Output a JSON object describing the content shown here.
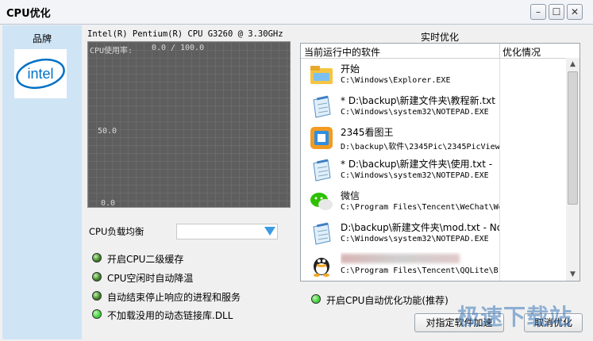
{
  "window": {
    "title": "CPU优化",
    "buttons": [
      "minimize",
      "maximize",
      "close"
    ]
  },
  "brand": {
    "title": "品牌",
    "logo_text": "intel"
  },
  "cpu": {
    "name": "Intel(R) Pentium(R) CPU G3260 @ 3.30GHz",
    "usage_label": "CPU使用率:",
    "usage_value": "0.0",
    "usage_sep": "/",
    "usage_max": "100.0",
    "mid_label": "50.0",
    "min_label": "0.0"
  },
  "balance": {
    "label": "CPU负载均衡",
    "selected": ""
  },
  "options": [
    {
      "label": "开启CPU二级缓存",
      "color": "#3a7d1e"
    },
    {
      "label": "CPU空闲时自动降温",
      "color": "#3a7d1e"
    },
    {
      "label": "自动结束停止响应的进程和服务",
      "color": "#3a7d1e"
    },
    {
      "label": "不加载没用的动态链接库.DLL",
      "color": "#3ed43a"
    }
  ],
  "realtime": {
    "title": "实时优化",
    "columns": [
      "当前运行中的软件",
      "优化情况"
    ],
    "rows": [
      {
        "name": "开始",
        "path": "C:\\Windows\\Explorer.EXE",
        "icon": "explorer-icon"
      },
      {
        "name": "* D:\\backup\\新建文件夹\\教程新.txt",
        "path": "C:\\Windows\\system32\\NOTEPAD.EXE",
        "icon": "notepad-icon"
      },
      {
        "name": "2345看图王",
        "path": "D:\\backup\\软件\\2345Pic\\2345PicView",
        "icon": "image-viewer-icon"
      },
      {
        "name": "* D:\\backup\\新建文件夹\\使用.txt -",
        "path": "C:\\Windows\\system32\\NOTEPAD.EXE",
        "icon": "notepad-icon"
      },
      {
        "name": "微信",
        "path": "C:\\Program Files\\Tencent\\WeChat\\We",
        "icon": "wechat-icon"
      },
      {
        "name": "D:\\backup\\新建文件夹\\mod.txt - No",
        "path": "C:\\Windows\\system32\\NOTEPAD.EXE",
        "icon": "notepad-icon"
      },
      {
        "name": "",
        "path": "C:\\Program Files\\Tencent\\QQLite\\B",
        "icon": "qq-icon"
      }
    ]
  },
  "auto_optimize": {
    "label": "开启CPU自动优化功能(推荐)",
    "color": "#3ed43a"
  },
  "buttons": {
    "optimize_selected": "对指定软件加速",
    "cancel_optimize": "取消优化"
  },
  "watermark": "极速下载站",
  "colors": {
    "accent": "#3a9be2",
    "panel": "#cfe5f6"
  }
}
